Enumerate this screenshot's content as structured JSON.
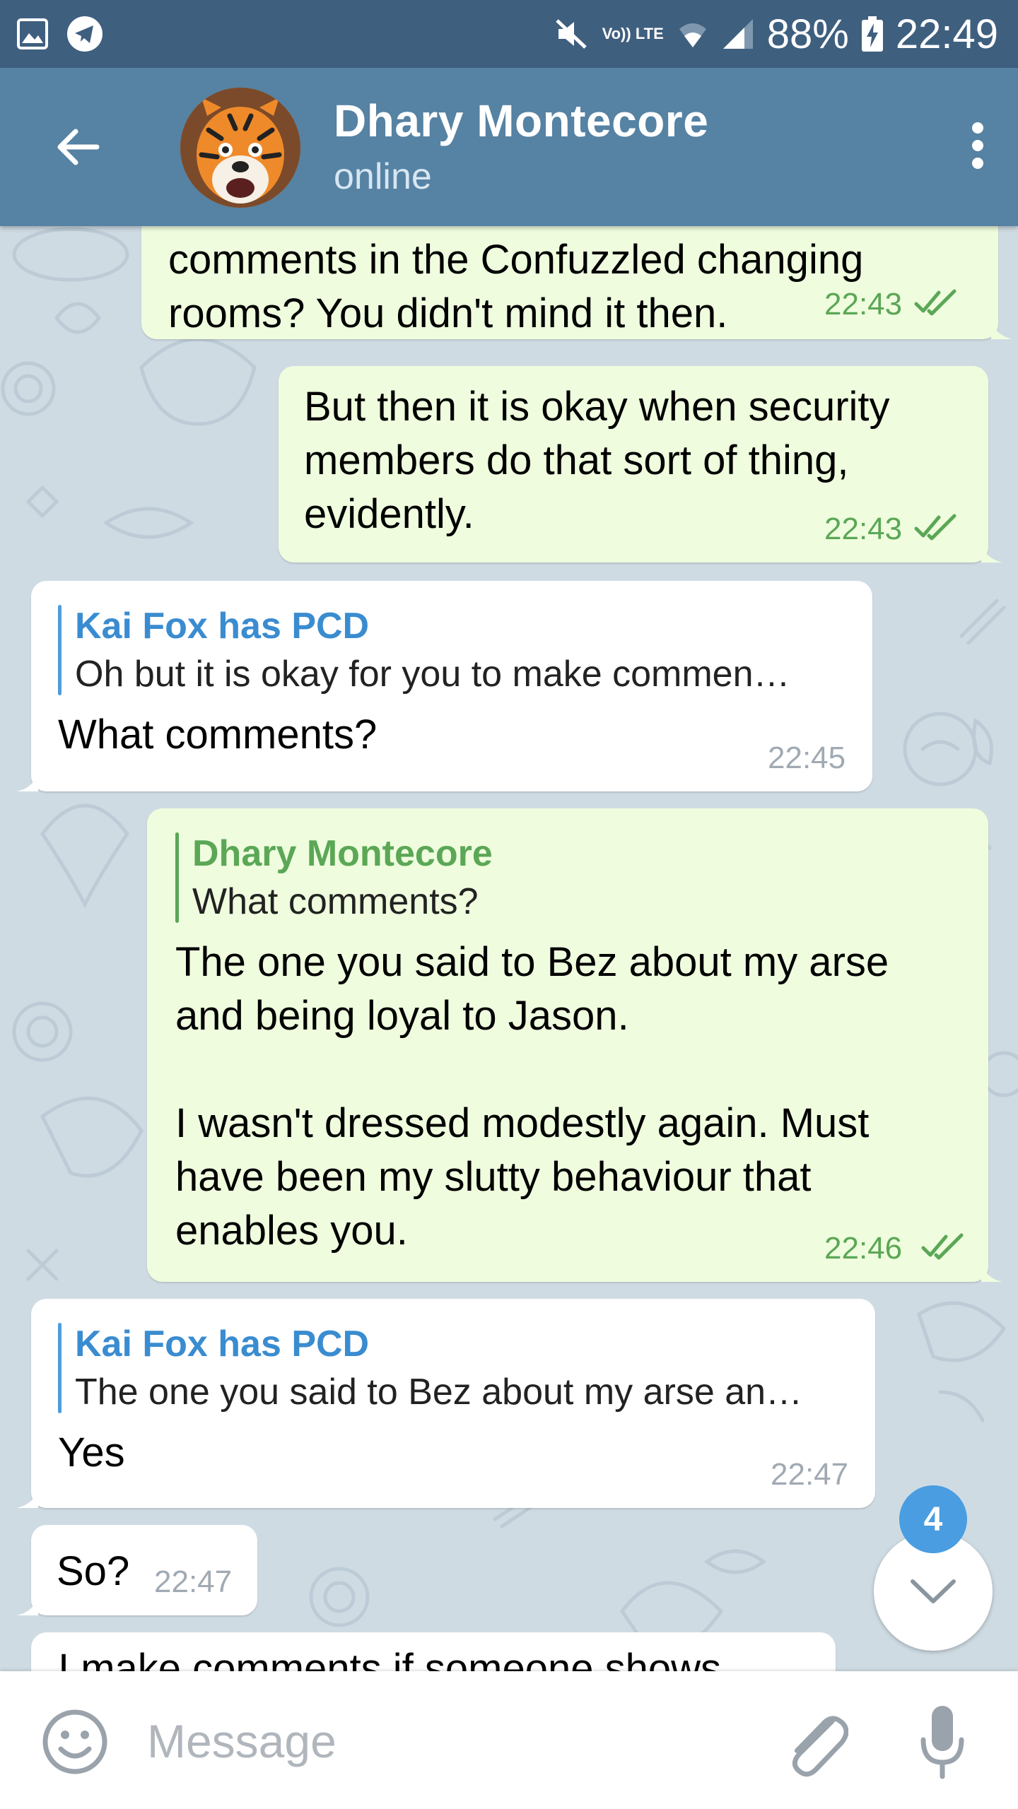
{
  "status_bar": {
    "battery": "88%",
    "time": "22:49",
    "network": "Vo)) LTE",
    "icons": [
      "gallery-icon",
      "telegram-icon",
      "mute-icon",
      "wifi-icon",
      "signal-icon",
      "battery-charging-icon"
    ]
  },
  "header": {
    "name": "Dhary Montecore",
    "status": "online"
  },
  "messages": [
    {
      "type": "out",
      "text": "comments in the Confuzzled changing\nrooms? You didn't mind it then.",
      "time": "22:43",
      "read": true
    },
    {
      "type": "out",
      "text": "But then it is okay when security\nmembers do that sort of thing,\nevidently.",
      "time": "22:43",
      "read": true
    },
    {
      "type": "in",
      "reply_name": "Kai Fox has PCD",
      "reply_text": "Oh but it is okay for you to make commen…",
      "text": "What comments?",
      "time": "22:45"
    },
    {
      "type": "out",
      "reply_name": "Dhary Montecore",
      "reply_text": "What comments?",
      "text": "The one you said to Bez about my arse\nand being loyal to Jason.\n\nI wasn't dressed modestly again. Must\nhave been my slutty behaviour that\nenables you.",
      "time": "22:46",
      "read": true
    },
    {
      "type": "in",
      "reply_name": "Kai Fox has PCD",
      "reply_text": "The one you said to Bez about my arse an…",
      "text": "Yes",
      "time": "22:47"
    },
    {
      "type": "in",
      "text": "So?",
      "time": "22:47"
    },
    {
      "type": "in",
      "text": "I make comments if someone shows",
      "time": ""
    }
  ],
  "scroll_button": {
    "unread_count": "4"
  },
  "input": {
    "placeholder": "Message"
  },
  "colors": {
    "header": "#5682a3",
    "status_bar": "#3f5f7f",
    "outgoing_bubble": "#effdde",
    "incoming_bubble": "#ffffff",
    "chat_background": "#cfdbe3",
    "accent_green": "#5ba756",
    "accent_blue": "#3a8cd0"
  }
}
